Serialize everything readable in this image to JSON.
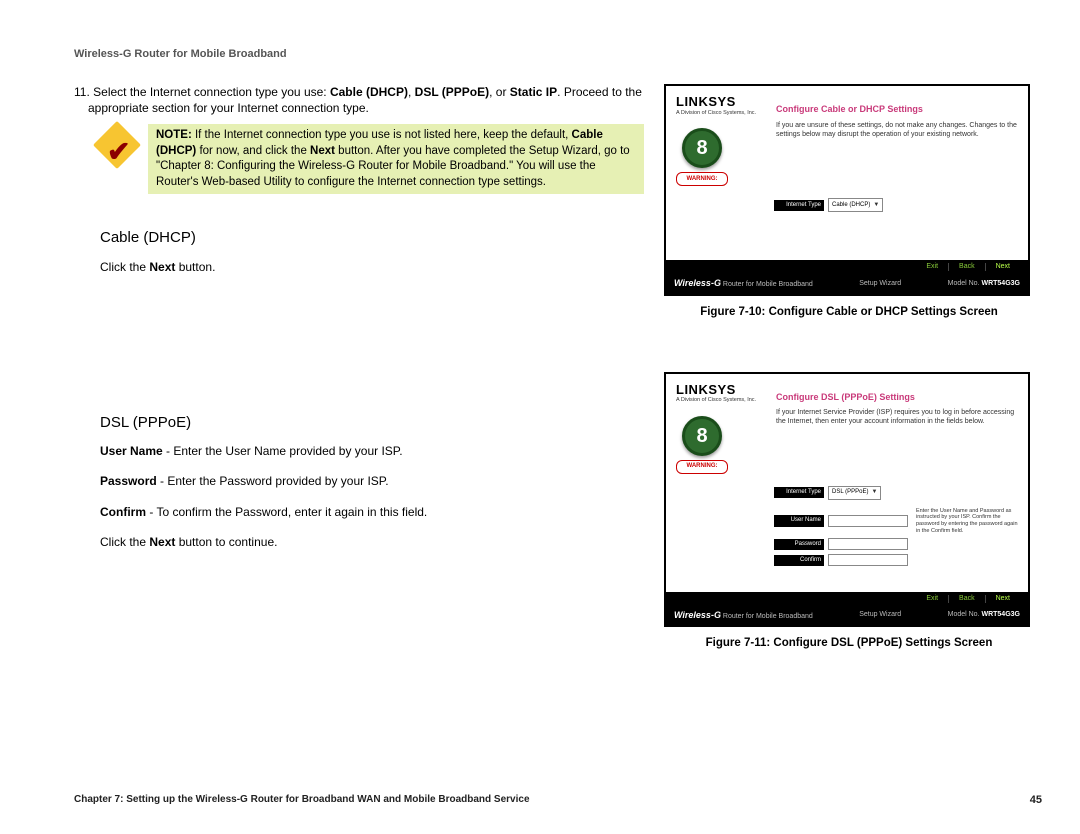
{
  "header": "Wireless-G Router for Mobile Broadband",
  "step": {
    "num": "11.",
    "text_a": "Select the Internet connection type you use: ",
    "b1": "Cable (DHCP)",
    "sep1": ", ",
    "b2": "DSL (PPPoE)",
    "sep2": ", or ",
    "b3": "Static IP",
    "text_b": ". Proceed to the appropriate section for your Internet connection type."
  },
  "note": {
    "label": "NOTE:",
    "t1": " If the Internet connection type you use is not listed here, keep the default, ",
    "b1": "Cable (DHCP)",
    "t2": " for now, and click the ",
    "b2": "Next",
    "t3": " button. After you have completed the Setup Wizard, go to \"Chapter 8: Configuring the Wireless-G Router for Mobile Broadband.\" You will use the Router's Web-based Utility to configure the Internet connection type settings."
  },
  "cable": {
    "heading": "Cable (DHCP)",
    "p1a": "Click the ",
    "p1b": "Next",
    "p1c": " button."
  },
  "dsl": {
    "heading": "DSL (PPPoE)",
    "p1b": "User Name",
    "p1t": " - Enter the User Name provided by your ISP.",
    "p2b": "Password",
    "p2t": " - Enter the Password provided by your ISP.",
    "p3b": "Confirm",
    "p3t": " - To confirm the Password, enter it again in this field.",
    "p4a": "Click the ",
    "p4b": "Next",
    "p4c": " button to continue."
  },
  "wiz": {
    "logo": "LINKSYS",
    "logosub": "A Division of Cisco Systems, Inc.",
    "step": "8",
    "warn": "WARNING:",
    "nav_exit": "Exit",
    "nav_back": "Back",
    "nav_next": "Next",
    "foot_wg": "Wireless-G",
    "foot_sub": " Router for Mobile Broadband",
    "foot_mid": "Setup Wizard",
    "foot_model_label": "Model No. ",
    "foot_model": "WRT54G3G",
    "internet_type": "Internet Type"
  },
  "wiz1": {
    "title": "Configure Cable or DHCP Settings",
    "desc": "If you are unsure of these settings, do not make any changes. Changes to the settings below may disrupt the operation of your existing network.",
    "dropdown": "Cable (DHCP)"
  },
  "wiz2": {
    "title": "Configure DSL (PPPoE) Settings",
    "desc": "If your Internet Service Provider (ISP) requires you to log in before accessing the Internet, then enter your account information in the fields below.",
    "dropdown": "DSL (PPPoE)",
    "user": "User Name",
    "pass": "Password",
    "conf": "Confirm",
    "helper": "Enter the User Name and Password as instructed by your ISP.  Confirm the password by entering the password again in the Confirm field."
  },
  "caption1": "Figure 7-10: Configure Cable or DHCP Settings Screen",
  "caption2": "Figure 7-11: Configure DSL (PPPoE) Settings Screen",
  "footer": {
    "chapter": "Chapter 7: Setting up the Wireless-G Router for Broadband WAN and Mobile Broadband Service",
    "page": "45"
  }
}
